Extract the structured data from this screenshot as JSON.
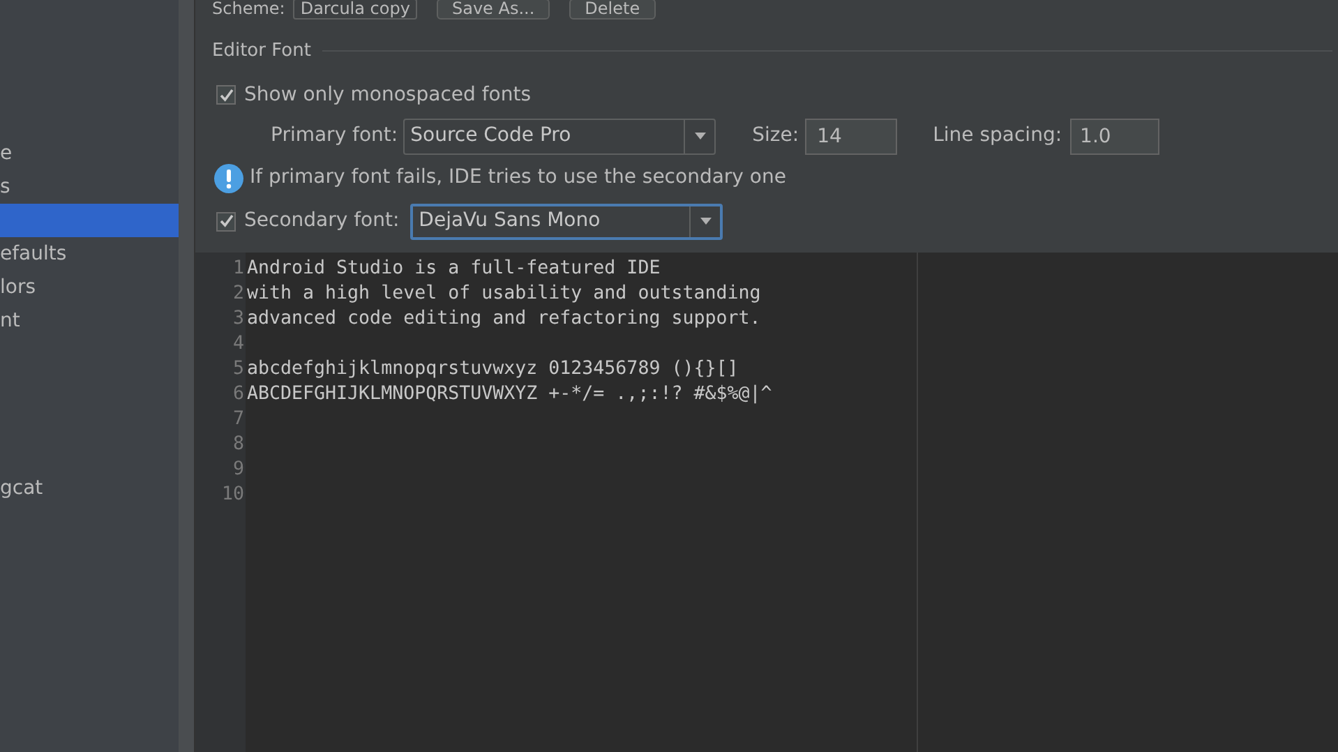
{
  "sidebar": {
    "items": [
      {
        "label": "e",
        "selected": false
      },
      {
        "label": "s",
        "selected": false
      },
      {
        "selected": true
      },
      {
        "label": "efaults",
        "selected": false
      },
      {
        "label": "lors",
        "selected": false
      },
      {
        "label": "nt",
        "selected": false
      },
      {
        "label": "gcat",
        "selected": false
      }
    ]
  },
  "scheme": {
    "label": "Scheme:",
    "value": "Darcula copy",
    "buttons": [
      "Save As...",
      "Delete"
    ]
  },
  "editor_font": {
    "title": "Editor Font",
    "show_monospaced": {
      "label": "Show only monospaced fonts",
      "checked": true
    },
    "primary_font": {
      "label": "Primary font:",
      "value": "Source Code Pro"
    },
    "size": {
      "label": "Size:",
      "value": "14"
    },
    "line_spacing": {
      "label": "Line spacing:",
      "value": "1.0"
    },
    "info": "If primary font fails, IDE tries to use the secondary one",
    "secondary_font": {
      "label": "Secondary font:",
      "value": "DejaVu Sans Mono",
      "checked": true
    }
  },
  "preview": {
    "lines": [
      {
        "number": "1",
        "text": "Android Studio is a full-featured IDE"
      },
      {
        "number": "2",
        "text": "with a high level of usability and outstanding"
      },
      {
        "number": "3",
        "text": "advanced code editing and refactoring support."
      },
      {
        "number": "4"
      },
      {
        "number": "5",
        "text": "abcdefghijklmnopqrstuvwxyz 0123456789 (){}[]"
      },
      {
        "number": "6",
        "text": "ABCDEFGHIJKLMNOPQRSTUVWXYZ +-*/= .,;:!? #&$%@|^"
      },
      {
        "number": "7"
      },
      {
        "number": "8"
      },
      {
        "number": "9"
      },
      {
        "number": "10"
      }
    ]
  }
}
